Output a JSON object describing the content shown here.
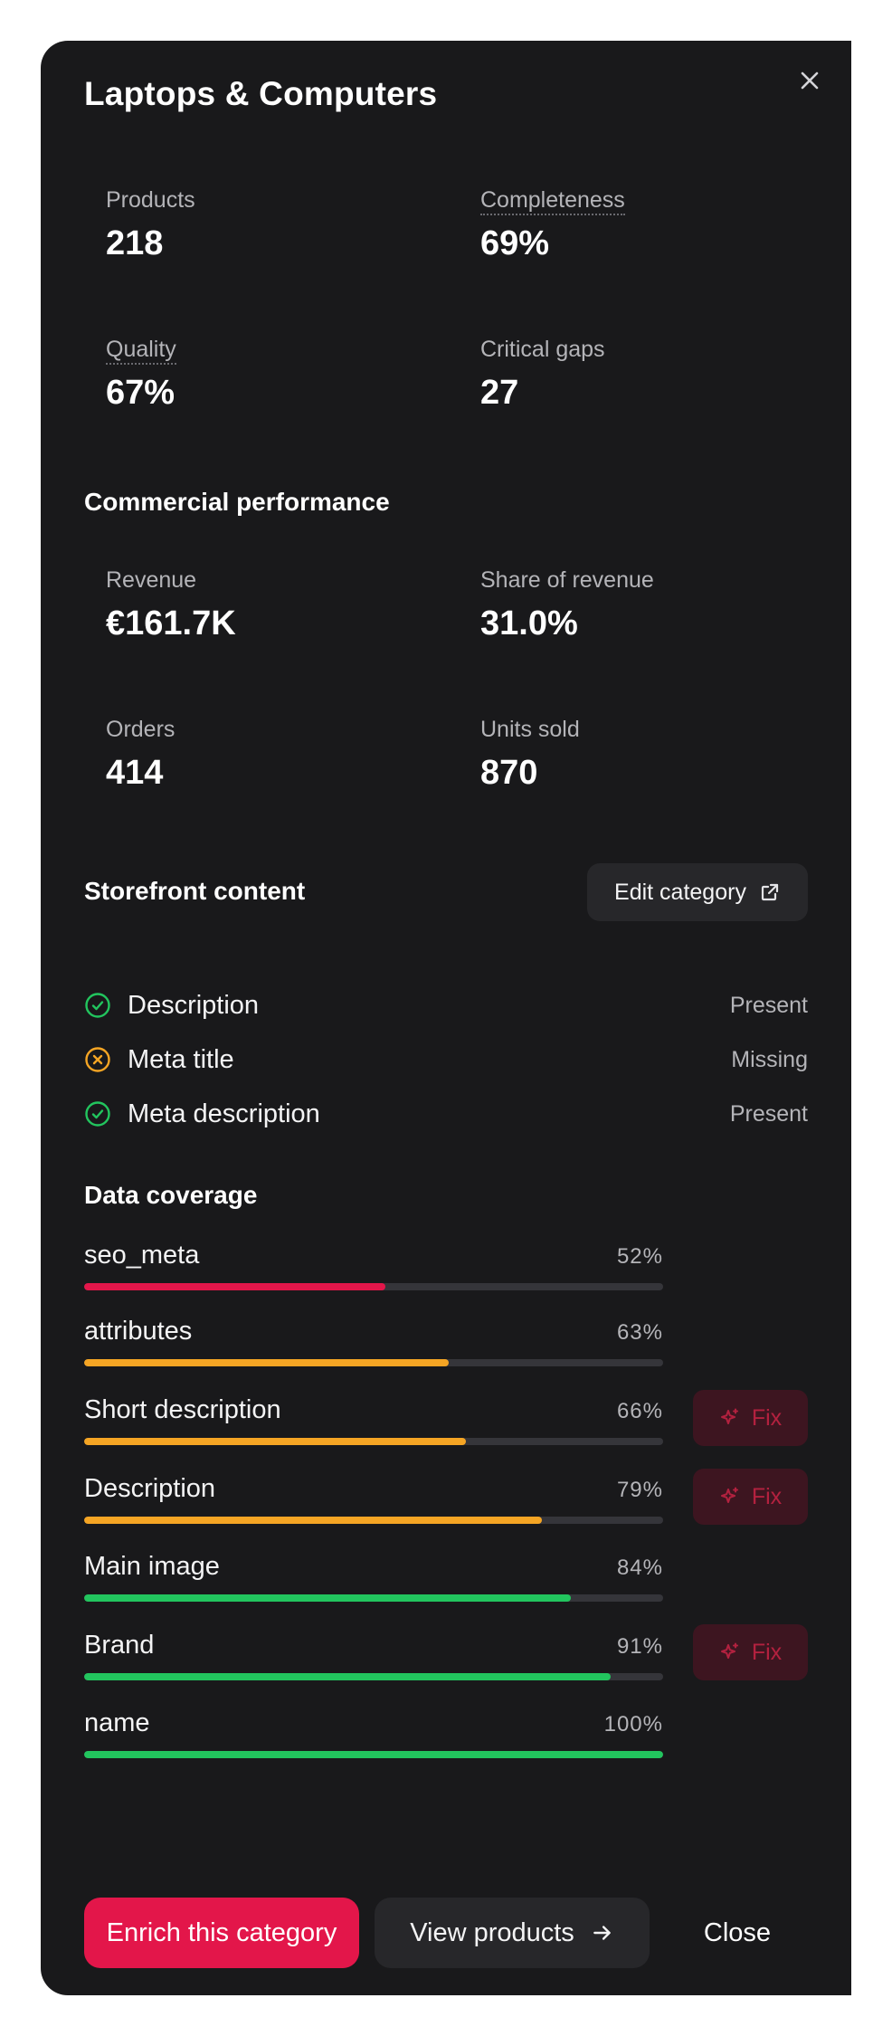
{
  "panel": {
    "title": "Laptops & Computers",
    "close_icon": "close-icon"
  },
  "overview": {
    "products": {
      "label": "Products",
      "value": "218"
    },
    "completeness": {
      "label": "Completeness",
      "value": "69%"
    },
    "quality": {
      "label": "Quality",
      "value": "67%"
    },
    "critical_gaps": {
      "label": "Critical gaps",
      "value": "27"
    }
  },
  "commercial": {
    "title": "Commercial performance",
    "revenue": {
      "label": "Revenue",
      "value": "€161.7K"
    },
    "share": {
      "label": "Share of revenue",
      "value": "31.0%"
    },
    "orders": {
      "label": "Orders",
      "value": "414"
    },
    "units": {
      "label": "Units sold",
      "value": "870"
    }
  },
  "storefront": {
    "title": "Storefront content",
    "edit_label": "Edit category",
    "items": [
      {
        "label": "Description",
        "status": "Present",
        "state": "ok"
      },
      {
        "label": "Meta title",
        "status": "Missing",
        "state": "missing"
      },
      {
        "label": "Meta description",
        "status": "Present",
        "state": "ok"
      }
    ]
  },
  "coverage": {
    "title": "Data coverage",
    "fix_label": "Fix",
    "items": [
      {
        "label": "seo_meta",
        "pct": "52%",
        "value": 0.52,
        "color": "#e3164a",
        "fix": false
      },
      {
        "label": "attributes",
        "pct": "63%",
        "value": 0.63,
        "color": "#f5a524",
        "fix": false
      },
      {
        "label": "Short description",
        "pct": "66%",
        "value": 0.66,
        "color": "#f5a524",
        "fix": true
      },
      {
        "label": "Description",
        "pct": "79%",
        "value": 0.79,
        "color": "#f5a524",
        "fix": true
      },
      {
        "label": "Main image",
        "pct": "84%",
        "value": 0.84,
        "color": "#22c55e",
        "fix": false
      },
      {
        "label": "Brand",
        "pct": "91%",
        "value": 0.91,
        "color": "#22c55e",
        "fix": true
      },
      {
        "label": "name",
        "pct": "100%",
        "value": 1.0,
        "color": "#22c55e",
        "fix": false
      }
    ]
  },
  "footer": {
    "enrich_label": "Enrich this category",
    "view_label": "View products",
    "close_label": "Close"
  },
  "colors": {
    "accent": "#e3164a",
    "ok": "#22c55e",
    "warn": "#f5a524",
    "panel_bg": "#19191b"
  }
}
